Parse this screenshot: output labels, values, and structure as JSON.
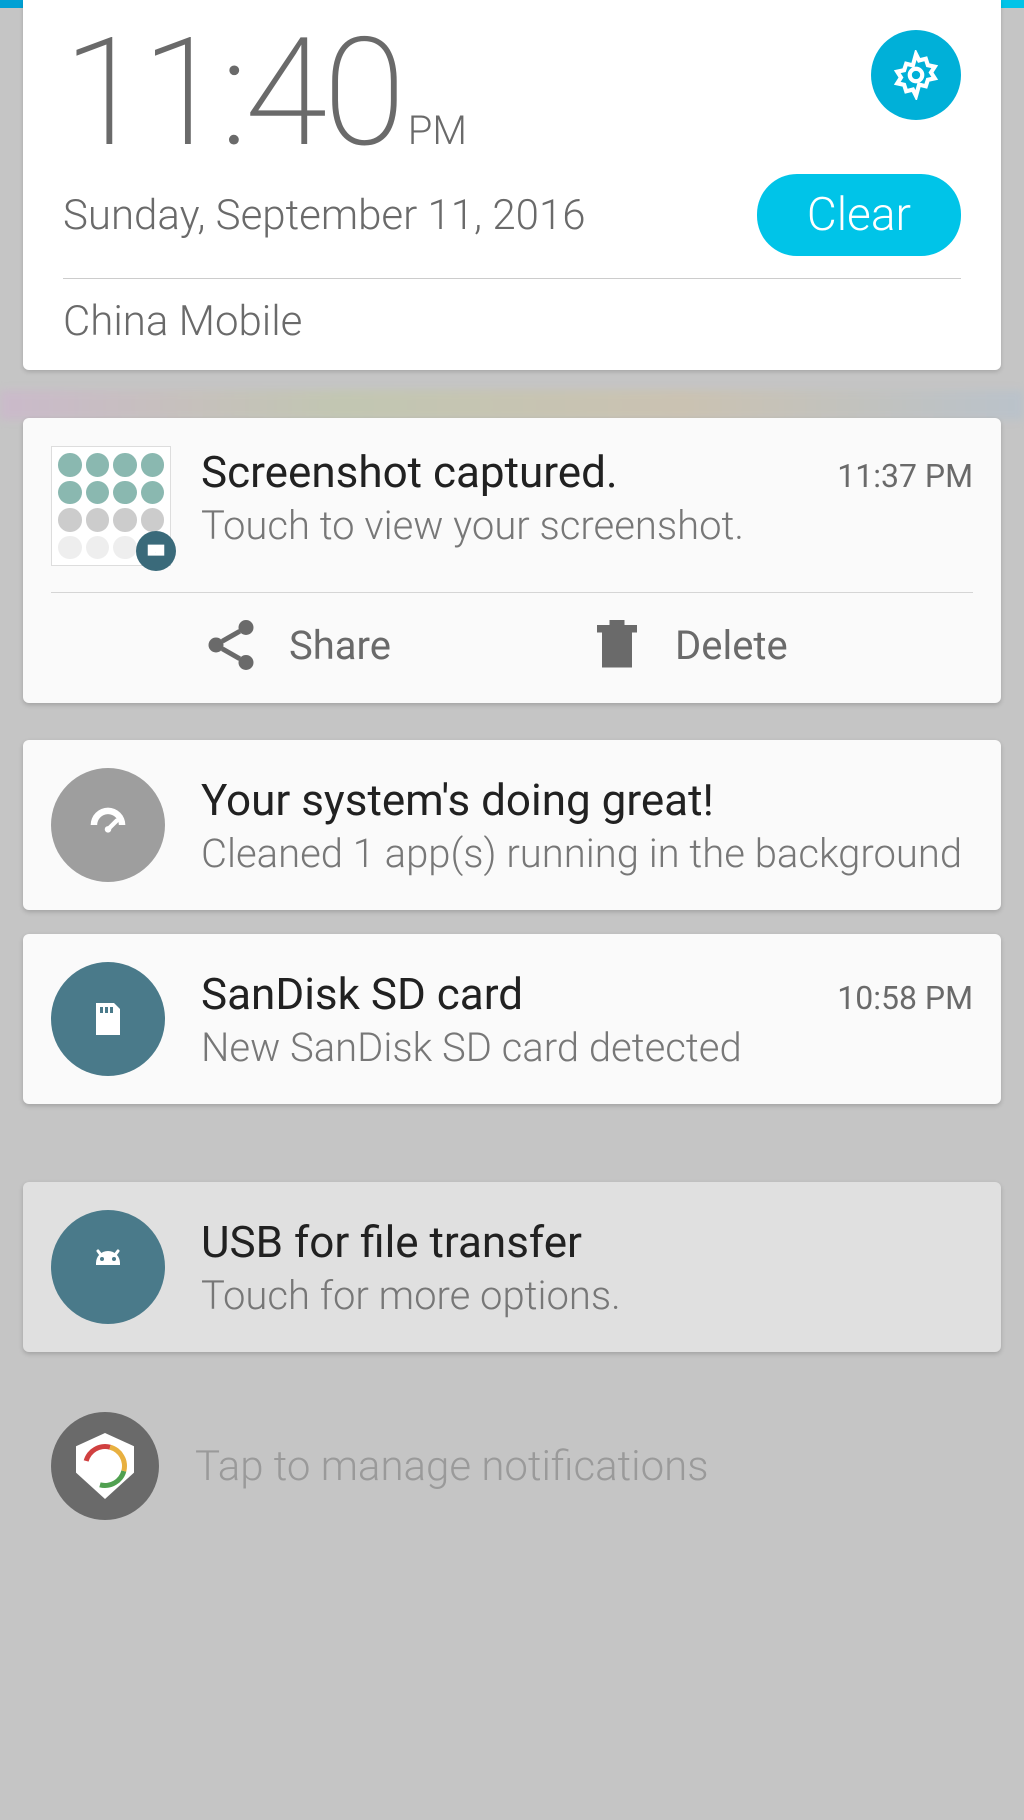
{
  "header": {
    "time": "11:40",
    "ampm": "PM",
    "date": "Sunday, September 11, 2016",
    "clear_label": "Clear",
    "carrier": "China Mobile"
  },
  "colors": {
    "accent": "#00c4e8",
    "icon_gray": "#9e9e9e",
    "icon_bluegray": "#4a7a8a",
    "icon_dark": "#6a6a6a"
  },
  "notifications": [
    {
      "id": "screenshot",
      "title": "Screenshot captured.",
      "subtitle": "Touch to view your screenshot.",
      "time": "11:37 PM",
      "actions": [
        {
          "icon": "share-icon",
          "label": "Share"
        },
        {
          "icon": "trash-icon",
          "label": "Delete"
        }
      ]
    },
    {
      "id": "system",
      "title": "Your system's doing great!",
      "subtitle": "Cleaned 1 app(s) running in the background",
      "time": ""
    },
    {
      "id": "sdcard",
      "title": "SanDisk SD card",
      "subtitle": "New SanDisk SD card detected",
      "time": "10:58 PM"
    },
    {
      "id": "usb",
      "title": "USB for file transfer",
      "subtitle": "Touch for more options.",
      "time": ""
    }
  ],
  "manage": {
    "label": "Tap to manage notifications"
  }
}
